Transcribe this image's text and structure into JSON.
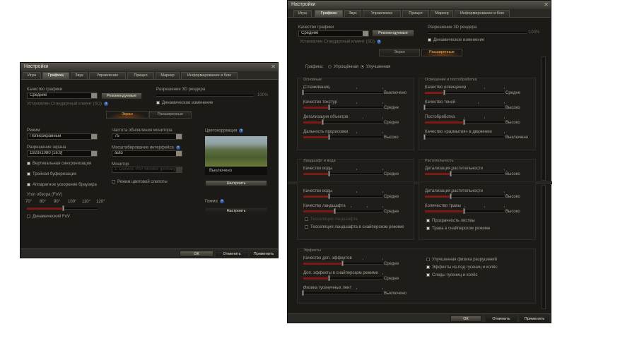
{
  "left": {
    "title": "Настройки",
    "tabs": [
      "Игра",
      "Графика",
      "Звук",
      "Управление",
      "Прицел",
      "Маркер",
      "Информирование в бою"
    ],
    "active_tab": 1,
    "quality_label": "Качество графики",
    "quality_value": "Средние",
    "recommended": "Рекомендуемые",
    "client_note": "Установлен Стандартный клиент (SD)",
    "render_label": "Разрешение 3D рендера",
    "render_value": "100%",
    "render_level": 1.0,
    "dynamic_change": "Динамическое изменение",
    "subtabs": [
      "Экран",
      "Расширенные"
    ],
    "mode_label": "Режим",
    "mode_value": "Полноэкранный",
    "res_label": "Разрешение экрана",
    "res_value": "1920x1080 [16:9]",
    "vsync": "Вертикальная синхронизация",
    "triple": "Тройная буферизация",
    "browser_accel": "Аппаратное ускорение браузера",
    "fov_label": "Угол обзора (FoV)",
    "fov_ticks": [
      "70°",
      "80°",
      "90°",
      "100°",
      "110°",
      "120°"
    ],
    "fov_level": 0.52,
    "dynamic_fov": "Динамический FoV",
    "refresh_label": "Частота обновления монитора",
    "refresh_value": "75",
    "scale_label": "Масштабирование интерфейса",
    "scale_value": "auto",
    "monitor_label": "Монитор",
    "monitor_value": "1: Generic PnP Monitor (primary)",
    "colorblind": "Режим цветовой слепоты",
    "color_corr_label": "Цветокоррекция",
    "color_corr_value": "Выключено",
    "configure": "Настроить",
    "gamma_label": "Гамма",
    "ok": "ОК",
    "cancel": "Отменить",
    "apply": "Применить"
  },
  "right": {
    "title": "Настройки",
    "tabs": [
      "Игра",
      "Графика",
      "Звук",
      "Управление",
      "Прицел",
      "Маркер",
      "Информирование в бою"
    ],
    "quality_label": "Качество графики",
    "quality_value": "Средние",
    "recommended": "Рекомендуемые",
    "client_note": "Установлен Стандартный клиент (SD)",
    "render_label": "Разрешение 3D рендера",
    "render_value": "100%",
    "dynamic_change": "Динамическое изменение",
    "subtabs": [
      "Экран",
      "Расширенные"
    ],
    "graphics_label": "Графика:",
    "radio_simple": "Упрощённая",
    "radio_improved": "Улучшенная",
    "groups": {
      "basic": {
        "title": "Основные",
        "sliders": [
          {
            "label": "Сглаживание",
            "value": "Выключено",
            "level": 0,
            "ticks": 4
          },
          {
            "label": "Качество текстур",
            "value": "Средне",
            "level": 0.33,
            "ticks": 4
          },
          {
            "label": "Детализация объектов",
            "value": "Средне",
            "level": 0.25,
            "ticks": 5
          },
          {
            "label": "Дальность прорисовки",
            "value": "Высоко",
            "level": 0.33,
            "ticks": 4
          }
        ]
      },
      "lighting": {
        "title": "Освещение и постобработка",
        "sliders": [
          {
            "label": "Качество освещения",
            "value": "Средне",
            "level": 0.25,
            "ticks": 5
          },
          {
            "label": "Качество теней",
            "value": "Высоко",
            "level": 0,
            "ticks": 4
          },
          {
            "label": "Постобработка",
            "value": "Высоко",
            "level": 0.5,
            "ticks": 5
          },
          {
            "label": "Качество «размытия» в движении",
            "value": "Выключено",
            "level": 0,
            "ticks": 4
          }
        ]
      },
      "landscape_top": {
        "title": "Ландшафт и вода",
        "sliders": [
          {
            "label": "Качество воды",
            "value": "Средне",
            "level": 0.33,
            "ticks": 4
          }
        ]
      },
      "vegetation_top": {
        "title": "Растительность",
        "sliders": [
          {
            "label": "Детализация растительности",
            "value": "Высоко",
            "level": 0.33,
            "ticks": 4
          }
        ]
      },
      "landscape": {
        "sliders": [
          {
            "label": "Качество воды",
            "value": "Средне",
            "level": 0.33,
            "ticks": 4
          },
          {
            "label": "Качество ландшафта",
            "value": "Средне",
            "level": 0.4,
            "ticks": 6
          }
        ],
        "checks": [
          {
            "label": "Тесселяция ландшафта",
            "on": false,
            "disabled": true
          },
          {
            "label": "Тесселяция ландшафта в снайперском режиме",
            "on": false,
            "disabled": false
          }
        ]
      },
      "vegetation": {
        "sliders": [
          {
            "label": "Детализация растительности",
            "value": "Высоко",
            "level": 0.33,
            "ticks": 4
          },
          {
            "label": "Количество травы",
            "value": "Высоко",
            "level": 0.5,
            "ticks": 5
          }
        ],
        "checks": [
          {
            "label": "Прозрачность листвы",
            "on": true,
            "disabled": false
          },
          {
            "label": "Трава в снайперском режиме",
            "on": true,
            "disabled": false
          }
        ]
      },
      "effects": {
        "title": "Эффекты",
        "sliders": [
          {
            "label": "Качество доп. эффектов",
            "value": "Средне",
            "level": 0.5,
            "ticks": 5
          },
          {
            "label": "Доп. эффекты в снайперском режиме",
            "value": "Средне",
            "level": 0.33,
            "ticks": 4
          },
          {
            "label": "Физика гусеничных лент",
            "value": "Выключено",
            "level": 0,
            "ticks": 4
          }
        ],
        "checks": [
          {
            "label": "Улучшенная физика разрушений",
            "on": false,
            "disabled": false
          },
          {
            "label": "Эффекты из-под гусениц и колёс",
            "on": true,
            "disabled": false
          },
          {
            "label": "Следы гусениц и колёс",
            "on": true,
            "disabled": false
          }
        ]
      }
    },
    "ok": "ОК",
    "cancel": "Отменить",
    "apply": "Применить"
  },
  "colors": {
    "accent_fill": "#7c1a13",
    "active_subtab_text": "#ffb24a",
    "info": "#2f5a9a"
  }
}
